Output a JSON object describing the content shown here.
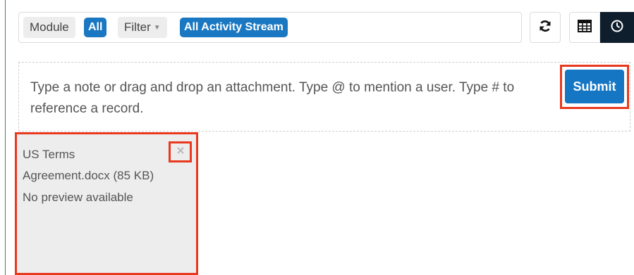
{
  "toolbar": {
    "module_label": "Module",
    "module_value": "All",
    "filter_label": "Filter",
    "filter_value": "All Activity Stream"
  },
  "view_buttons": {
    "refresh_icon": "refresh-icon",
    "list_icon": "table-icon",
    "timeline_icon": "clock-icon"
  },
  "composer": {
    "placeholder": "Type a note or drag and drop an attachment. Type @ to mention a user. Type # to reference a record.",
    "submit_label": "Submit"
  },
  "attachment": {
    "file_name_line1": "US Terms",
    "file_name_line2": "Agreement.docx (85 KB)",
    "preview_text": "No preview available",
    "close_icon": "close-icon"
  },
  "colors": {
    "accent_blue": "#1a78c2",
    "highlight_red": "#e8391f",
    "active_dark": "#0e1e2c"
  }
}
